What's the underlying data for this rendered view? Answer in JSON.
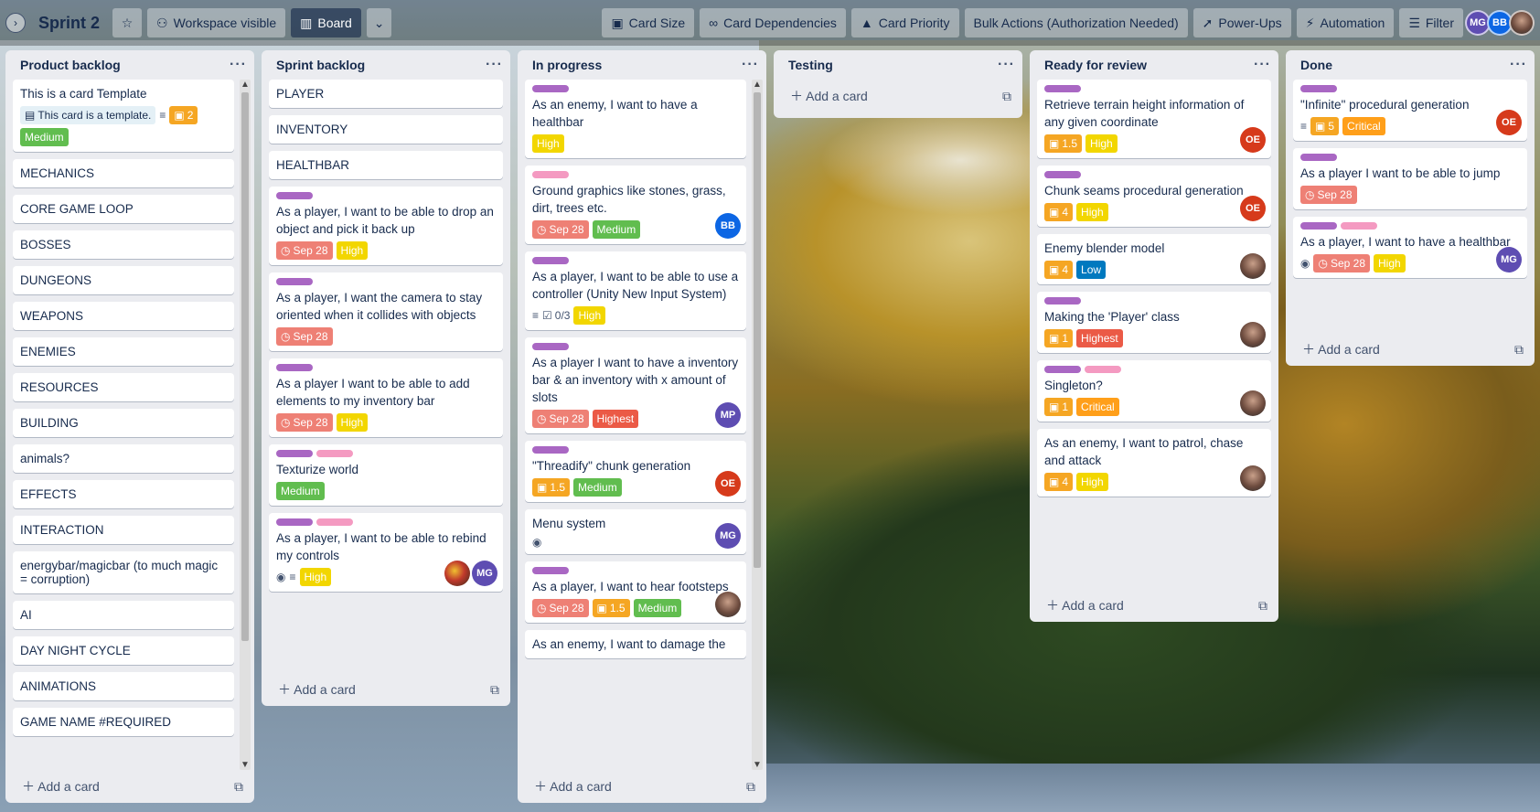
{
  "header": {
    "board_title": "Sprint 2",
    "visibility": "Workspace visible",
    "view": "Board",
    "card_size": "Card Size",
    "card_dependencies": "Card Dependencies",
    "card_priority": "Card Priority",
    "bulk_actions": "Bulk Actions (Authorization Needed)",
    "power_ups": "Power-Ups",
    "automation": "Automation",
    "filter": "Filter",
    "members": [
      "MG",
      "BB"
    ]
  },
  "add_card_label": "Add a card",
  "lists": {
    "product_backlog": {
      "title": "Product backlog",
      "template_card": {
        "title": "This is a card Template",
        "template_badge": "This card is a template.",
        "size": "2",
        "priority": "Medium"
      },
      "items": [
        "MECHANICS",
        "CORE GAME LOOP",
        "BOSSES",
        "DUNGEONS",
        "WEAPONS",
        "ENEMIES",
        "RESOURCES",
        "BUILDING",
        "animals?",
        "EFFECTS",
        "INTERACTION",
        "energybar/magicbar (to much magic = corruption)",
        "AI",
        "DAY NIGHT CYCLE",
        "ANIMATIONS",
        "GAME NAME #REQUIRED"
      ]
    },
    "sprint_backlog": {
      "title": "Sprint backlog",
      "simple": [
        "PLAYER",
        "INVENTORY",
        "HEALTHBAR"
      ],
      "cards": [
        {
          "title": "As a player, I want to be able to drop an object and pick it back up",
          "date": "Sep 28",
          "priority": "High"
        },
        {
          "title": "As a player, I want the camera to stay oriented when it collides with objects",
          "date": "Sep 28"
        },
        {
          "title": "As a player I want to be able to add elements to my inventory bar",
          "date": "Sep 28",
          "priority": "High"
        },
        {
          "title": "Texturize world",
          "priority": "Medium"
        },
        {
          "title": "As a player, I want to be able to rebind my controls",
          "priority": "High",
          "avatar": "MG"
        }
      ]
    },
    "in_progress": {
      "title": "In progress",
      "cards": [
        {
          "title": "As an enemy, I want to have a healthbar",
          "priority": "High"
        },
        {
          "title": "Ground graphics like stones, grass, dirt, trees etc.",
          "date": "Sep 28",
          "priority": "Medium",
          "avatar": "BB"
        },
        {
          "title": "As a player, I want to be able to use a controller (Unity New Input System)",
          "checklist": "0/3",
          "priority": "High"
        },
        {
          "title": "As a player I want to have a inventory bar & an inventory with x amount of slots",
          "date": "Sep 28",
          "priority": "Highest",
          "avatar": "MP"
        },
        {
          "title": "\"Threadify\" chunk generation",
          "size": "1.5",
          "priority": "Medium",
          "avatar": "OE"
        },
        {
          "title": "Menu system",
          "avatar": "MG"
        },
        {
          "title": "As a player, I want to hear footsteps",
          "date": "Sep 28",
          "size": "1.5",
          "priority": "Medium"
        },
        {
          "title": "As an enemy, I want to damage the"
        }
      ]
    },
    "testing": {
      "title": "Testing"
    },
    "ready_for_review": {
      "title": "Ready for review",
      "cards": [
        {
          "title": "Retrieve terrain height information of any given coordinate",
          "size": "1.5",
          "priority": "High",
          "avatar": "OE"
        },
        {
          "title": "Chunk seams procedural generation",
          "size": "4",
          "priority": "High",
          "avatar": "OE"
        },
        {
          "title": "Enemy blender model",
          "size": "4",
          "priority": "Low"
        },
        {
          "title": "Making the 'Player' class",
          "size": "1",
          "priority": "Highest"
        },
        {
          "title": "Singleton?",
          "size": "1",
          "priority": "Critical"
        },
        {
          "title": "As an enemy, I want to patrol, chase and attack",
          "size": "4",
          "priority": "High"
        }
      ]
    },
    "done": {
      "title": "Done",
      "cards": [
        {
          "title": "\"Infinite\" procedural generation",
          "size": "5",
          "priority": "Critical",
          "avatar": "OE"
        },
        {
          "title": "As a player I want to be able to jump",
          "date": "Sep 28"
        },
        {
          "title": "As a player, I want to have a healthbar",
          "date": "Sep 28",
          "priority": "High",
          "avatar": "MG"
        }
      ]
    }
  }
}
